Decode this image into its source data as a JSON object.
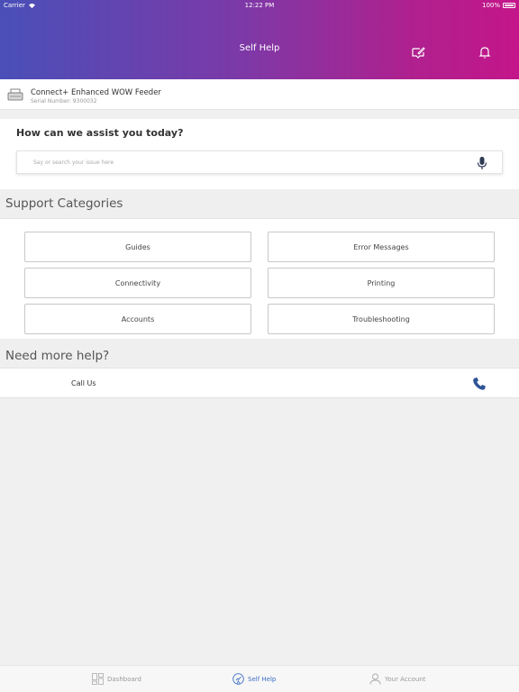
{
  "status_bar": {
    "carrier": "Carrier",
    "time": "12:22 PM",
    "battery": "100%"
  },
  "header": {
    "title": "Self Help",
    "icons": [
      "feedback-icon",
      "bell-icon"
    ]
  },
  "device": {
    "name": "Connect+ Enhanced WOW Feeder",
    "serial": "Serial Number: 9300032"
  },
  "assist": {
    "title": "How can we assist you today?",
    "placeholder": "Say or search your issue here"
  },
  "support": {
    "title": "Support Categories",
    "categories": [
      "Guides",
      "Error Messages",
      "Connectivity",
      "Printing",
      "Accounts",
      "Troubleshooting"
    ]
  },
  "help": {
    "title": "Need more help?",
    "call_label": "Call Us"
  },
  "tabs": [
    {
      "label": "Dashboard",
      "icon": "dashboard-icon",
      "active": false
    },
    {
      "label": "Self Help",
      "icon": "self-help-icon",
      "active": true
    },
    {
      "label": "Your Account",
      "icon": "user-icon",
      "active": false
    }
  ],
  "colors": {
    "gradient_start": "#4a4fb8",
    "gradient_end": "#c4168a",
    "accent": "#3c6ec4",
    "phone": "#2f5596"
  }
}
